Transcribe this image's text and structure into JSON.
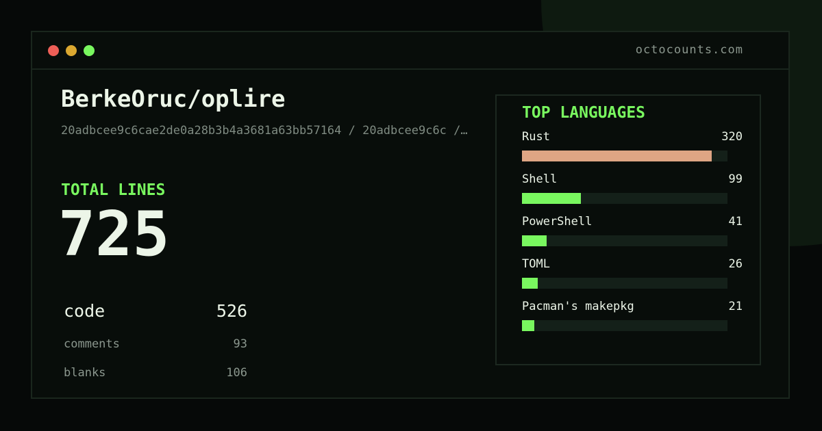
{
  "site": "octocounts.com",
  "repo": "BerkeOruc/oplire",
  "commit": "20adbcee9c6cae2de0a28b3b4a3681a63bb57164 / 20adbcee9c6c /…",
  "total": {
    "label": "TOTAL LINES",
    "value": "725"
  },
  "stats": {
    "code": {
      "label": "code",
      "value": "526"
    },
    "comments": {
      "label": "comments",
      "value": "93"
    },
    "blanks": {
      "label": "blanks",
      "value": "106"
    }
  },
  "languages": {
    "title": "TOP LANGUAGES",
    "max": 346,
    "items": [
      {
        "name": "Rust",
        "lines": 320,
        "color": "#dea584"
      },
      {
        "name": "Shell",
        "lines": 99,
        "color": "#79f75f"
      },
      {
        "name": "PowerShell",
        "lines": 41,
        "color": "#79f75f"
      },
      {
        "name": "TOML",
        "lines": 26,
        "color": "#79f75f"
      },
      {
        "name": "Pacman's makepkg",
        "lines": 21,
        "color": "#79f75f"
      }
    ]
  },
  "colors": {
    "accent": "#79f75f",
    "text": "#ecf5e8",
    "muted": "#8b978e",
    "background": "#060908"
  },
  "window_controls": [
    "close",
    "minimize",
    "maximize"
  ]
}
